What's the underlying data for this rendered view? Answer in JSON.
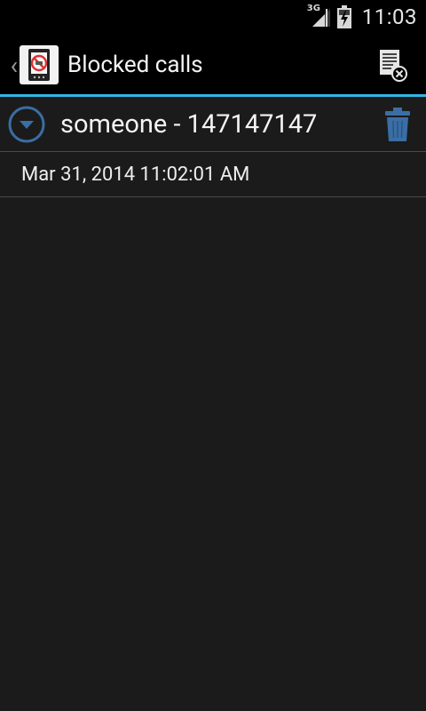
{
  "status_bar": {
    "network_type": "3G",
    "time": "11:03",
    "icons": [
      "signal-icon",
      "battery-charging-icon"
    ]
  },
  "action_bar": {
    "up_icon": "chevron-left-icon",
    "app_icon": "blocked-phone-app-icon",
    "title": "Blocked calls",
    "action_icon": "clear-log-icon"
  },
  "blocked_calls": [
    {
      "caller": "someone - 147147147",
      "expanded": true,
      "timestamp": "Mar 31, 2014 11:02:01 AM"
    }
  ],
  "colors": {
    "accent": "#33b5e5",
    "icon_blue": "#3a6ea5",
    "background": "#1b1b1b",
    "bar": "#000000"
  }
}
